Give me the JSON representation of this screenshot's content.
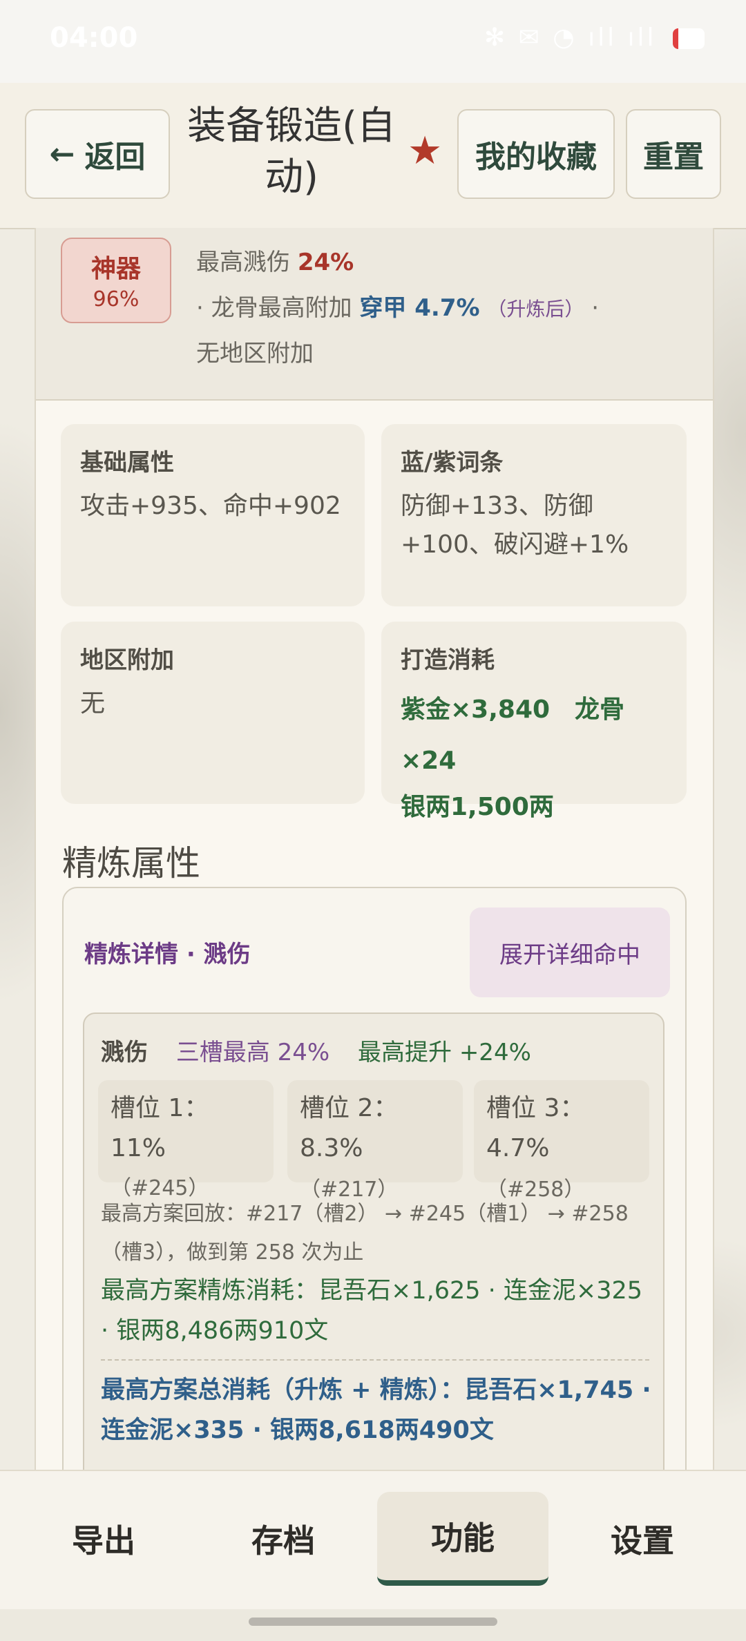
{
  "status_bar": {
    "time": "04:00",
    "icons": "✻ ✉ ◔ ıll ıll"
  },
  "header": {
    "back_label": "返回",
    "title_line1": "装备锻造(自",
    "title_line2": "动)",
    "favorites_label": "我的收藏",
    "reset_label": "重置"
  },
  "summary": {
    "badge_title": "神器",
    "badge_percent": "96%",
    "max_splash_label": "最高溅伤",
    "max_splash_value": "24%",
    "dragon_prefix": "· 龙骨最高附加",
    "dragon_stat": "穿甲 4.7%",
    "dragon_note": "（升炼后）",
    "dragon_suffix": "·",
    "region_line": "无地区附加"
  },
  "cards": {
    "base": {
      "title": "基础属性",
      "value": "攻击+935、命中+902"
    },
    "affix": {
      "title": "蓝/紫词条",
      "value": "防御+133、防御+100、破闪避+1%"
    },
    "region": {
      "title": "地区附加",
      "value": "无"
    },
    "cost": {
      "title": "打造消耗",
      "line1": "紫金×3,840　龙骨×24",
      "line2": "银两1,500两"
    }
  },
  "refine": {
    "section_title": "精炼属性",
    "detail_title": "精炼详情 · 溅伤",
    "expand_label": "展开详细命中",
    "stat_label": "溅伤",
    "three_slot_max": "三槽最高 24%",
    "max_gain": "最高提升 +24%",
    "slots": [
      {
        "line1": "槽位 1：11%",
        "line2": "（#245）"
      },
      {
        "line1": "槽位 2：",
        "line2": "8.3%",
        "line2b": "（#217）"
      },
      {
        "line1": "槽位 3：",
        "line2": "4.7%",
        "line2b": "（#258）"
      }
    ],
    "replay_note": "最高方案回放：#217（槽2） → #245（槽1） → #258（槽3），做到第 258 次为止",
    "refine_cost": "最高方案精炼消耗：昆吾石×1,625 · 连金泥×325 · 银两8,486两910文",
    "total_cost": "最高方案总消耗（升炼 + 精炼）：昆吾石×1,745 · 连金泥×335 · 银两8,618两490文"
  },
  "bottom_nav": {
    "export": "导出",
    "save": "存档",
    "function": "功能",
    "settings": "设置",
    "active": "功能"
  }
}
